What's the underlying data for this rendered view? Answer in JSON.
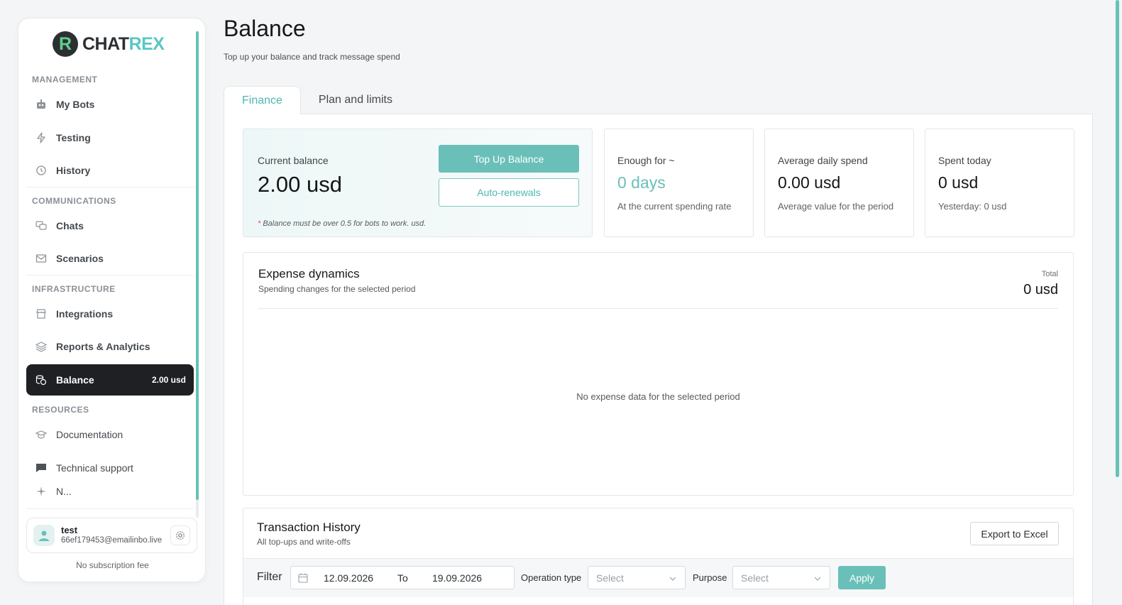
{
  "brand": {
    "mark": "R",
    "name_a": "CHAT",
    "name_b": "REX"
  },
  "sidebar": {
    "sections": {
      "management": "MANAGEMENT",
      "communications": "COMMUNICATIONS",
      "infrastructure": "INFRASTRUCTURE",
      "resources": "RESOURCES"
    },
    "items": {
      "my_bots": "My Bots",
      "testing": "Testing",
      "history": "History",
      "chats": "Chats",
      "scenarios": "Scenarios",
      "integrations": "Integrations",
      "reports": "Reports & Analytics",
      "balance": "Balance",
      "balance_badge": "2.00 usd",
      "documentation": "Documentation",
      "support": "Technical support",
      "cut_off": "N..."
    },
    "user": {
      "name": "test",
      "email": "66ef179453@emailinbo.live"
    },
    "subscription": "No subscription fee"
  },
  "header": {
    "title": "Balance",
    "subtitle": "Top up your balance and track message spend"
  },
  "tabs": [
    "Finance",
    "Plan and limits"
  ],
  "balance": {
    "label": "Current balance",
    "value": "2.00 usd",
    "top_up": "Top Up Balance",
    "auto_renewals": "Auto-renewals",
    "note_star": "*",
    "note": " Balance must be over 0.5 for bots to work. usd."
  },
  "stats": {
    "enough": {
      "label": "Enough for ~",
      "value": "0 days",
      "note": "At the current spending rate"
    },
    "average": {
      "label": "Average daily spend",
      "value": "0.00 usd",
      "note": "Average value for the period"
    },
    "today": {
      "label": "Spent today",
      "value": "0 usd",
      "note": "Yesterday: 0 usd"
    }
  },
  "expense": {
    "title": "Expense dynamics",
    "subtitle": "Spending changes for the selected period",
    "total_label": "Total",
    "total_value": "0 usd",
    "empty": "No expense data for the selected period"
  },
  "transactions": {
    "title": "Transaction History",
    "subtitle": "All top-ups and write-offs",
    "export": "Export to Excel",
    "filter": {
      "label": "Filter",
      "date_from": "12.09.2026",
      "to_label": "To",
      "date_to": "19.09.2026",
      "op_type_label": "Operation type",
      "op_type_placeholder": "Select",
      "purpose_label": "Purpose",
      "purpose_placeholder": "Select",
      "apply": "Apply"
    }
  },
  "colors": {
    "accent": "#6ac0b8",
    "accent_text": "#4fb7ae",
    "active_nav": "#1e2023"
  }
}
